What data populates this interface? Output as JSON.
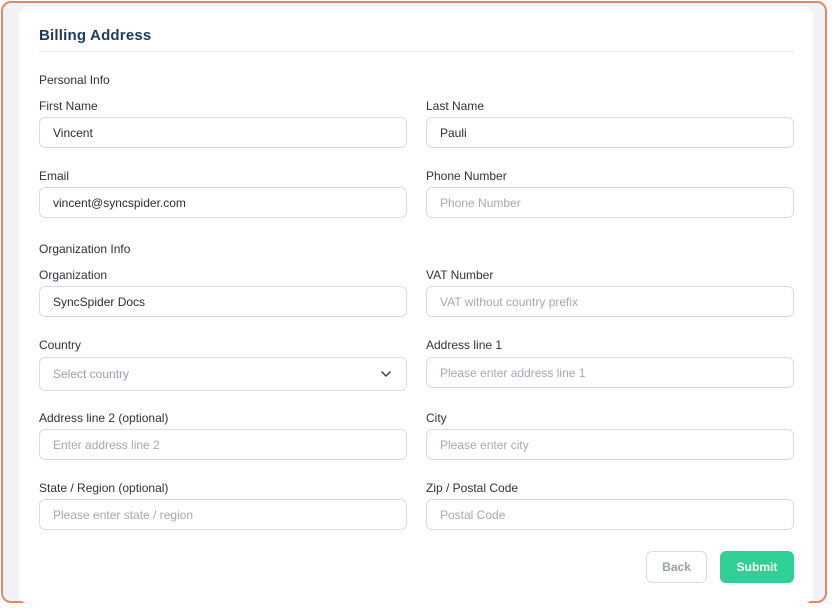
{
  "form": {
    "title": "Billing Address",
    "sections": {
      "personal": "Personal Info",
      "organization": "Organization Info"
    },
    "fields": {
      "first_name": {
        "label": "First Name",
        "value": "Vincent",
        "placeholder": ""
      },
      "last_name": {
        "label": "Last Name",
        "value": "Pauli",
        "placeholder": ""
      },
      "email": {
        "label": "Email",
        "value": "vincent@syncspider.com",
        "placeholder": ""
      },
      "phone": {
        "label": "Phone Number",
        "value": "",
        "placeholder": "Phone Number"
      },
      "organization": {
        "label": "Organization",
        "value": "SyncSpider Docs",
        "placeholder": ""
      },
      "vat": {
        "label": "VAT Number",
        "value": "",
        "placeholder": "VAT without country prefix"
      },
      "country": {
        "label": "Country",
        "selected": "Select country"
      },
      "address1": {
        "label": "Address line 1",
        "value": "",
        "placeholder": "Please enter address line 1"
      },
      "address2": {
        "label": "Address line 2 (optional)",
        "value": "",
        "placeholder": "Enter address line 2"
      },
      "city": {
        "label": "City",
        "value": "",
        "placeholder": "Please enter city"
      },
      "state": {
        "label": "State / Region (optional)",
        "value": "",
        "placeholder": "Please enter state / region"
      },
      "zip": {
        "label": "Zip / Postal Code",
        "value": "",
        "placeholder": "Postal Code"
      }
    },
    "buttons": {
      "back": "Back",
      "submit": "Submit"
    }
  },
  "colors": {
    "frame_border": "#e0876a",
    "title": "#1f3a5f",
    "submit": "#2fcf95"
  },
  "icons": {
    "country_select": "chevron-down-icon"
  }
}
